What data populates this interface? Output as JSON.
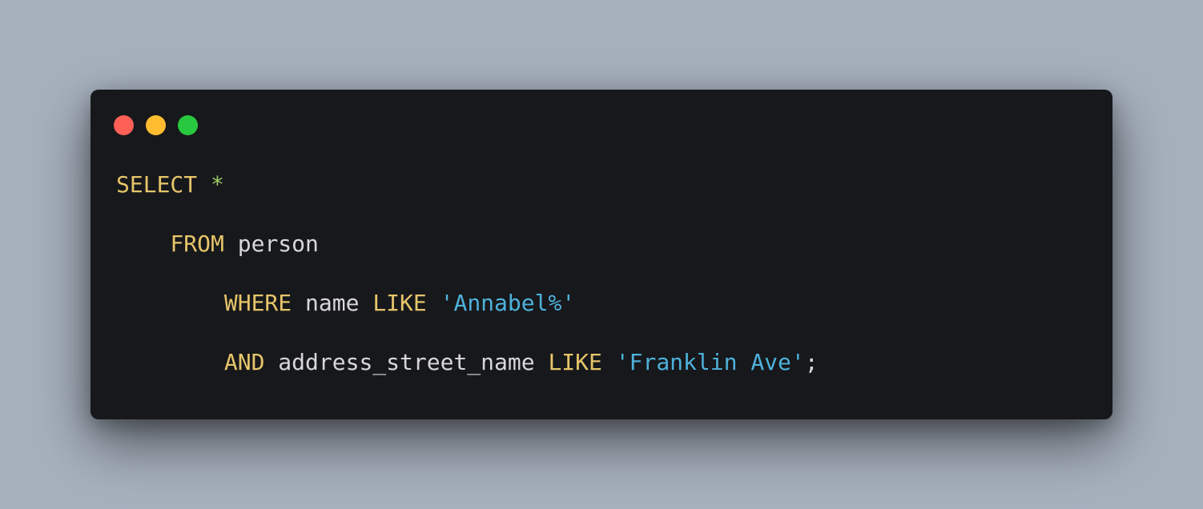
{
  "window": {
    "controls": [
      {
        "name": "close",
        "color": "#fe5f57"
      },
      {
        "name": "minimize",
        "color": "#febc2e"
      },
      {
        "name": "maximize",
        "color": "#28c840"
      }
    ]
  },
  "code": {
    "line1": {
      "kw_select": "SELECT",
      "star": "*"
    },
    "line2": {
      "kw_from": "FROM",
      "table": "person"
    },
    "line3": {
      "kw_where": "WHERE",
      "col": "name",
      "kw_like": "LIKE",
      "value": "'Annabel%'"
    },
    "line4": {
      "kw_and": "AND",
      "col": "address_street_name",
      "kw_like": "LIKE",
      "value": "'Franklin Ave'",
      "terminator": ";"
    }
  }
}
